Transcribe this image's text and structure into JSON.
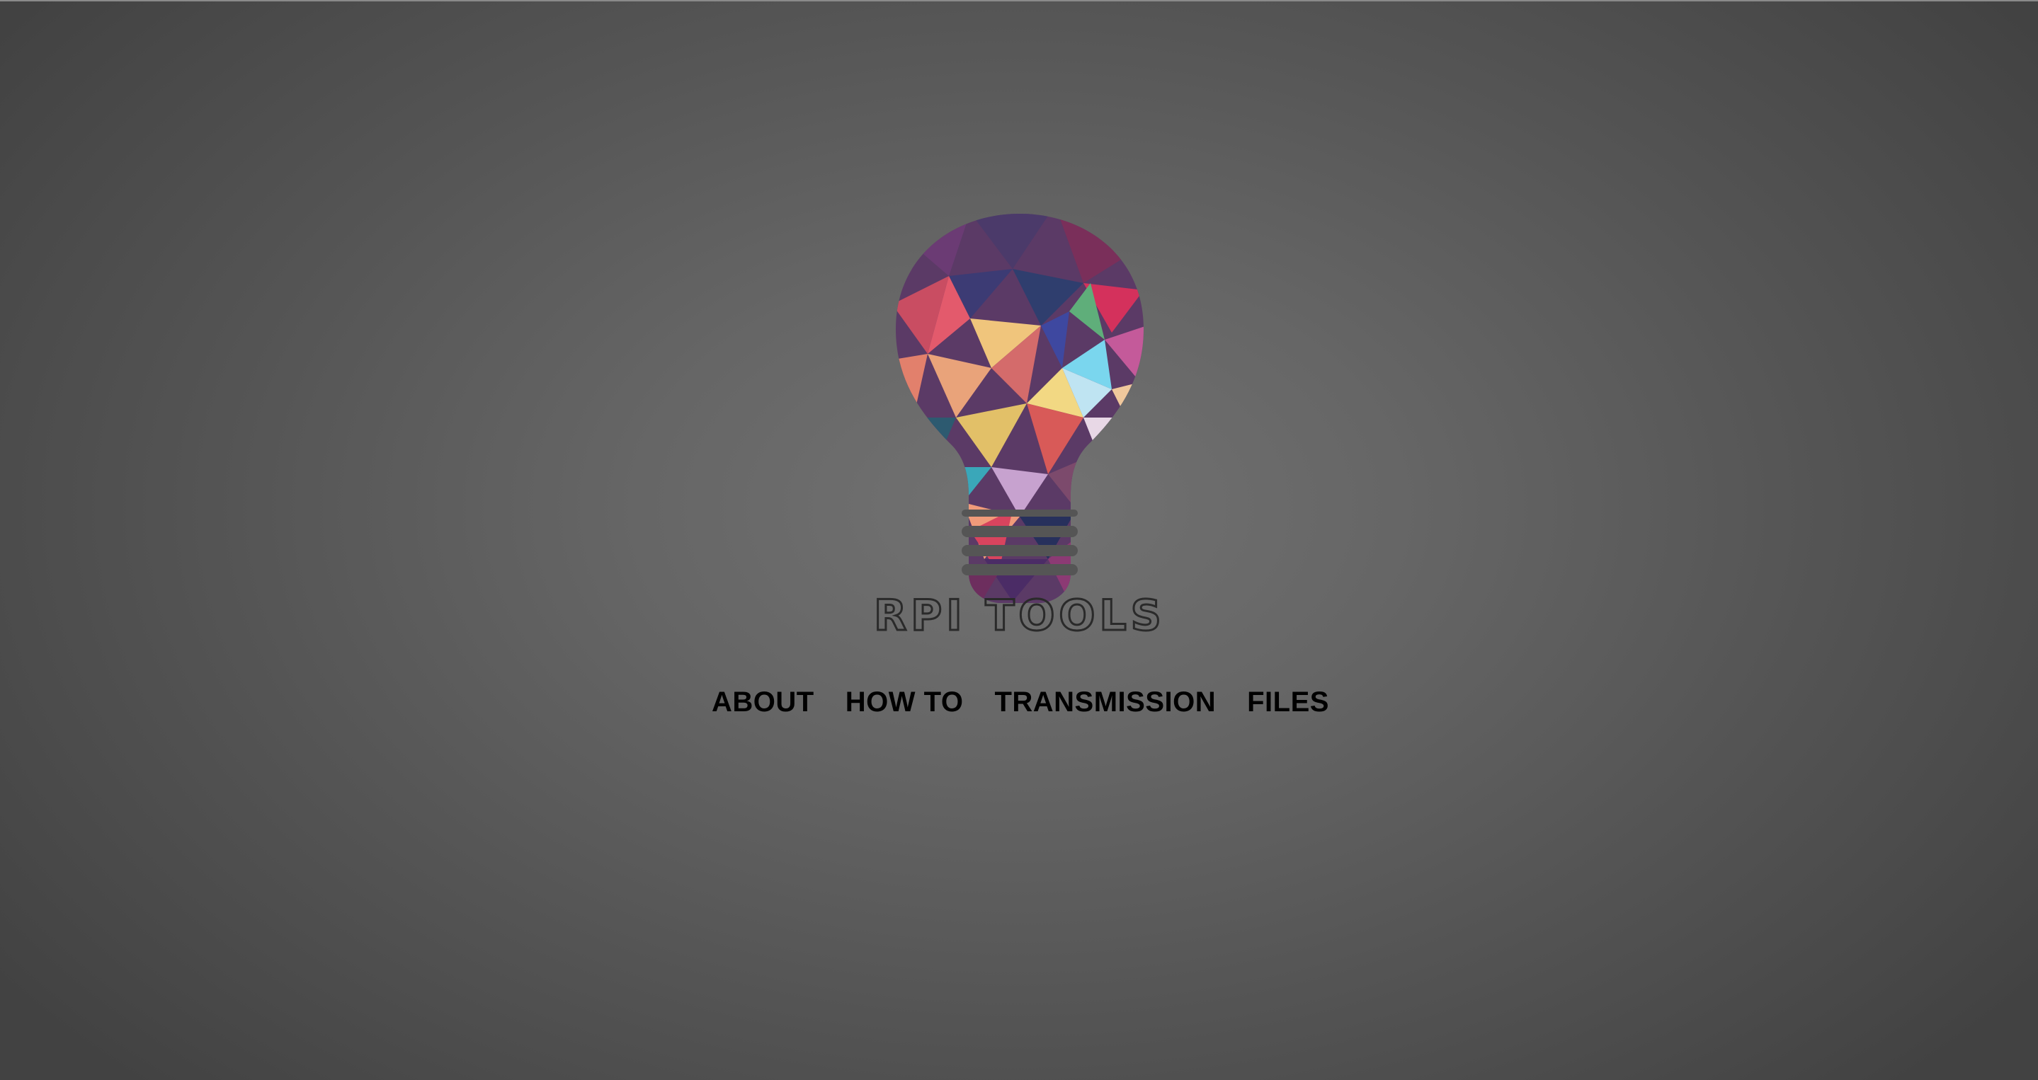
{
  "brand": {
    "logo_text": "RPI TOOLS",
    "logo_icon": "lightbulb-icon"
  },
  "nav": {
    "items": [
      {
        "label": "ABOUT"
      },
      {
        "label": "HOW TO"
      },
      {
        "label": "TRANSMISSION"
      },
      {
        "label": "FILES"
      }
    ]
  },
  "colors": {
    "background_center": "#727272",
    "background_edge": "#424242",
    "nav_text": "#000000",
    "logo_text": "#2a2a2a"
  }
}
